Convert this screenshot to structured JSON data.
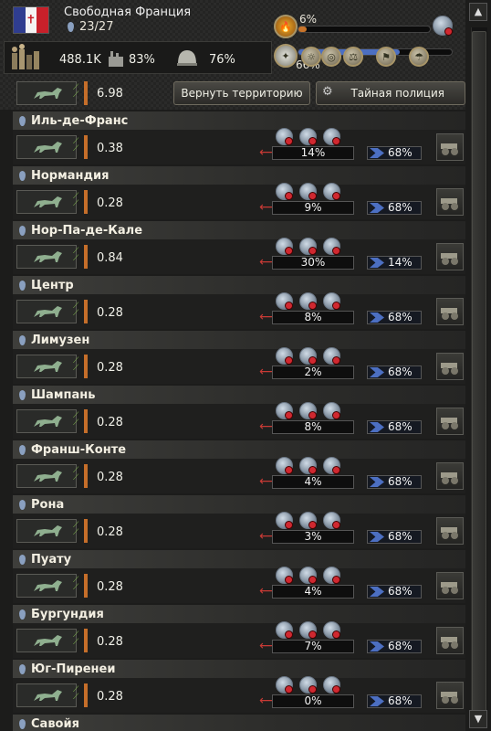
{
  "header": {
    "country_name": "Свободная Франция",
    "states_count": "23/27",
    "manpower": "488.1K",
    "industry_pct": "83%",
    "garrison_pct": "76%",
    "resistance_value": "6.98",
    "return_territory_label": "Вернуть территорию",
    "secret_police_label": "Тайная полиция",
    "top_bar_pct": "6%",
    "top_bar_fill": 0.06,
    "compliance_top_pct": "66%",
    "compliance_top_fill": 0.66
  },
  "colors": {
    "accent_orange": "#c56e2a",
    "resistance_green": "#7fb34e",
    "compliance_blue": "#4c6fc2",
    "resistance_red": "#c83a35"
  },
  "states": [
    {
      "name": "Иль-де-Франс",
      "resistance": "0.38",
      "resistance_pct": "14%",
      "compliance_pct": "68%"
    },
    {
      "name": "Нормандия",
      "resistance": "0.28",
      "resistance_pct": "9%",
      "compliance_pct": "68%"
    },
    {
      "name": "Нор-Па-де-Кале",
      "resistance": "0.84",
      "resistance_pct": "30%",
      "compliance_pct": "14%"
    },
    {
      "name": "Центр",
      "resistance": "0.28",
      "resistance_pct": "8%",
      "compliance_pct": "68%"
    },
    {
      "name": "Лимузен",
      "resistance": "0.28",
      "resistance_pct": "2%",
      "compliance_pct": "68%"
    },
    {
      "name": "Шампань",
      "resistance": "0.28",
      "resistance_pct": "8%",
      "compliance_pct": "68%"
    },
    {
      "name": "Франш-Конте",
      "resistance": "0.28",
      "resistance_pct": "4%",
      "compliance_pct": "68%"
    },
    {
      "name": "Рона",
      "resistance": "0.28",
      "resistance_pct": "3%",
      "compliance_pct": "68%"
    },
    {
      "name": "Пуату",
      "resistance": "0.28",
      "resistance_pct": "4%",
      "compliance_pct": "68%"
    },
    {
      "name": "Бургундия",
      "resistance": "0.28",
      "resistance_pct": "7%",
      "compliance_pct": "68%"
    },
    {
      "name": "Юг-Пиренеи",
      "resistance": "0.28",
      "resistance_pct": "0%",
      "compliance_pct": "68%"
    },
    {
      "name": "Савойя",
      "resistance": "",
      "resistance_pct": "",
      "compliance_pct": ""
    }
  ]
}
